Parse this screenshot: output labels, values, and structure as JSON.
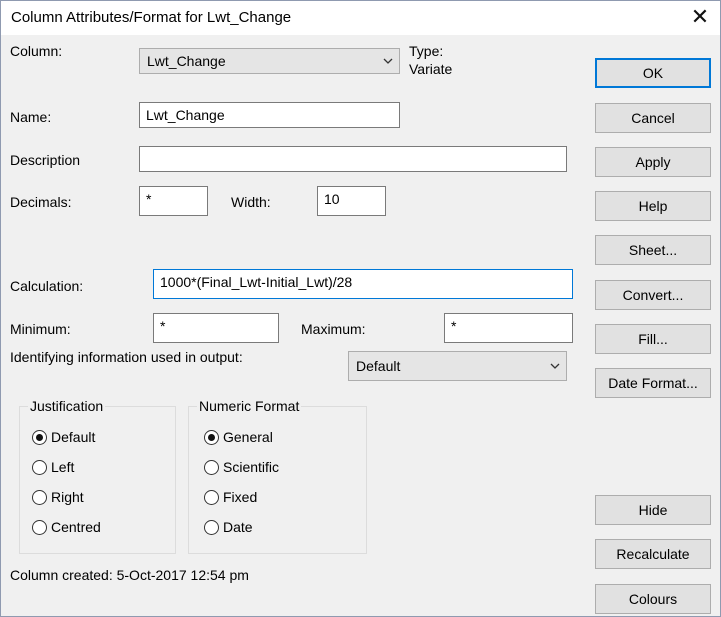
{
  "window": {
    "title": "Column Attributes/Format for Lwt_Change"
  },
  "form": {
    "column_label": "Column:",
    "column_value": "Lwt_Change",
    "type_label": "Type:",
    "type_value": "Variate",
    "name_label": "Name:",
    "name_value": "Lwt_Change",
    "description_label": "Description",
    "description_value": "",
    "decimals_label": "Decimals:",
    "decimals_value": "*",
    "width_label": "Width:",
    "width_value": "10",
    "calculation_label": "Calculation:",
    "calculation_value": "1000*(Final_Lwt-Initial_Lwt)/28",
    "minimum_label": "Minimum:",
    "minimum_value": "*",
    "maximum_label": "Maximum:",
    "maximum_value": "*",
    "identifying_label": "Identifying information used in output:",
    "identifying_value": "Default"
  },
  "justification": {
    "title": "Justification",
    "options": [
      "Default",
      "Left",
      "Right",
      "Centred"
    ],
    "selected": "Default"
  },
  "numeric_format": {
    "title": "Numeric Format",
    "options": [
      "General",
      "Scientific",
      "Fixed",
      "Date"
    ],
    "selected": "General"
  },
  "status": {
    "created": "Column created: 5-Oct-2017 12:54 pm"
  },
  "buttons": {
    "ok": "OK",
    "cancel": "Cancel",
    "apply": "Apply",
    "help": "Help",
    "sheet": "Sheet...",
    "convert": "Convert...",
    "fill": "Fill...",
    "date_format": "Date Format...",
    "hide": "Hide",
    "recalculate": "Recalculate",
    "colours": "Colours"
  },
  "colors": {
    "accent": "#0078d7",
    "background": "#f0f0f0",
    "titlebar": "#ffffff"
  },
  "icons": {
    "close": "close-icon",
    "dropdown": "chevron-down-icon"
  }
}
